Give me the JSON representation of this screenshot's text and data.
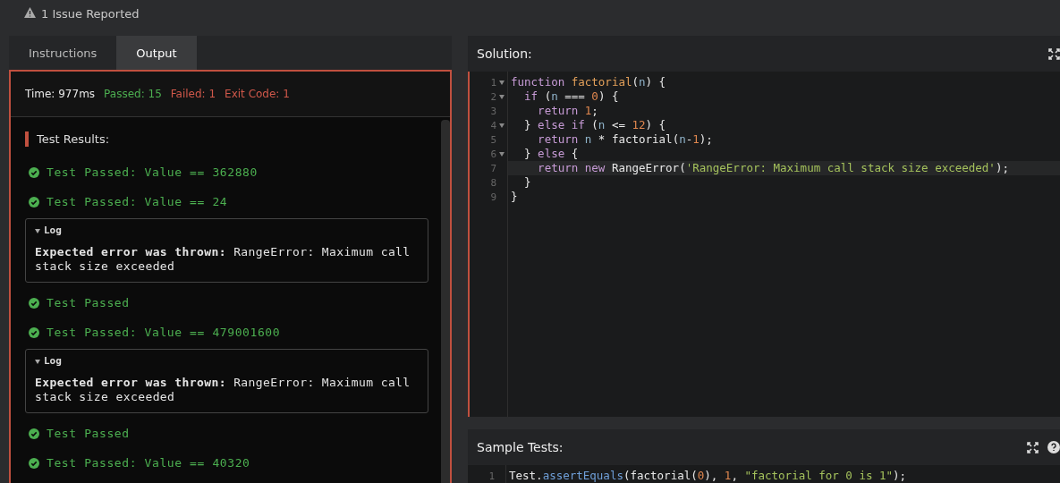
{
  "issue_banner": {
    "text": "1 Issue Reported"
  },
  "tabs": [
    {
      "label": "Instructions",
      "selected": false
    },
    {
      "label": "Output",
      "selected": true
    }
  ],
  "output": {
    "status": [
      {
        "kind": "neutral",
        "text": "Time: 977ms"
      },
      {
        "kind": "pass",
        "text": "Passed: 15"
      },
      {
        "kind": "fail",
        "text": "Failed: 1"
      },
      {
        "kind": "fail",
        "text": "Exit Code: 1"
      }
    ],
    "results_title": "Test Results:",
    "results": [
      {
        "kind": "passed",
        "text": "Test Passed: Value == 362880"
      },
      {
        "kind": "passed",
        "text": "Test Passed: Value == 24"
      },
      {
        "kind": "log",
        "label": "Log",
        "expanded": true,
        "message": "**Expected error was thrown:** RangeError: Maximum call stack size exceeded"
      },
      {
        "kind": "passed",
        "text": "Test Passed"
      },
      {
        "kind": "passed",
        "text": "Test Passed: Value == 479001600"
      },
      {
        "kind": "log",
        "label": "Log",
        "expanded": true,
        "message": "**Expected error was thrown:** RangeError: Maximum call stack size exceeded"
      },
      {
        "kind": "passed",
        "text": "Test Passed"
      },
      {
        "kind": "passed",
        "text": "Test Passed: Value == 40320"
      }
    ]
  },
  "solution": {
    "title": "Solution:",
    "lines": [
      {
        "number": "1",
        "foldable": true,
        "active": false,
        "tokens": [
          {
            "kind": "keyword",
            "text": "function "
          },
          {
            "kind": "func",
            "text": "factorial"
          },
          {
            "kind": "plain",
            "text": "("
          },
          {
            "kind": "param",
            "text": "n"
          },
          {
            "kind": "plain",
            "text": ") {"
          }
        ]
      },
      {
        "number": "2",
        "foldable": true,
        "active": false,
        "tokens": [
          {
            "kind": "keyword",
            "text": "  if "
          },
          {
            "kind": "plain",
            "text": "("
          },
          {
            "kind": "param",
            "text": "n"
          },
          {
            "kind": "plain",
            "text": " === "
          },
          {
            "kind": "number",
            "text": "0"
          },
          {
            "kind": "plain",
            "text": ") {"
          }
        ]
      },
      {
        "number": "3",
        "foldable": false,
        "active": false,
        "tokens": [
          {
            "kind": "keyword",
            "text": "    return "
          },
          {
            "kind": "number",
            "text": "1"
          },
          {
            "kind": "plain",
            "text": ";"
          }
        ]
      },
      {
        "number": "4",
        "foldable": true,
        "active": false,
        "tokens": [
          {
            "kind": "plain",
            "text": "  } "
          },
          {
            "kind": "keyword",
            "text": "else if "
          },
          {
            "kind": "plain",
            "text": "("
          },
          {
            "kind": "param",
            "text": "n"
          },
          {
            "kind": "plain",
            "text": " <= "
          },
          {
            "kind": "number",
            "text": "12"
          },
          {
            "kind": "plain",
            "text": ") {"
          }
        ]
      },
      {
        "number": "5",
        "foldable": false,
        "active": false,
        "tokens": [
          {
            "kind": "keyword",
            "text": "    return "
          },
          {
            "kind": "param",
            "text": "n"
          },
          {
            "kind": "plain",
            "text": " * factorial("
          },
          {
            "kind": "param",
            "text": "n"
          },
          {
            "kind": "plain",
            "text": "-"
          },
          {
            "kind": "number",
            "text": "1"
          },
          {
            "kind": "plain",
            "text": ");"
          }
        ]
      },
      {
        "number": "6",
        "foldable": true,
        "active": false,
        "tokens": [
          {
            "kind": "plain",
            "text": "  } "
          },
          {
            "kind": "keyword",
            "text": "else "
          },
          {
            "kind": "plain",
            "text": "{"
          }
        ]
      },
      {
        "number": "7",
        "foldable": false,
        "active": true,
        "tokens": [
          {
            "kind": "keyword",
            "text": "    return new "
          },
          {
            "kind": "plain",
            "text": "RangeError("
          },
          {
            "kind": "string",
            "text": "'RangeError: Maximum call stack size exceeded'"
          },
          {
            "kind": "plain",
            "text": ");"
          }
        ]
      },
      {
        "number": "8",
        "foldable": false,
        "active": false,
        "tokens": [
          {
            "kind": "plain",
            "text": "  }"
          }
        ]
      },
      {
        "number": "9",
        "foldable": false,
        "active": false,
        "tokens": [
          {
            "kind": "plain",
            "text": "}"
          }
        ]
      }
    ]
  },
  "sample_tests": {
    "title": "Sample Tests:",
    "lines": [
      {
        "number": "1",
        "foldable": false,
        "active": false,
        "tokens": [
          {
            "kind": "plain",
            "text": "Test."
          },
          {
            "kind": "method",
            "text": "assertEquals"
          },
          {
            "kind": "plain",
            "text": "(factorial("
          },
          {
            "kind": "number",
            "text": "0"
          },
          {
            "kind": "plain",
            "text": "), "
          },
          {
            "kind": "number",
            "text": "1"
          },
          {
            "kind": "plain",
            "text": ", "
          },
          {
            "kind": "string",
            "text": "\"factorial for 0 is 1\""
          },
          {
            "kind": "plain",
            "text": ");"
          }
        ]
      }
    ]
  }
}
